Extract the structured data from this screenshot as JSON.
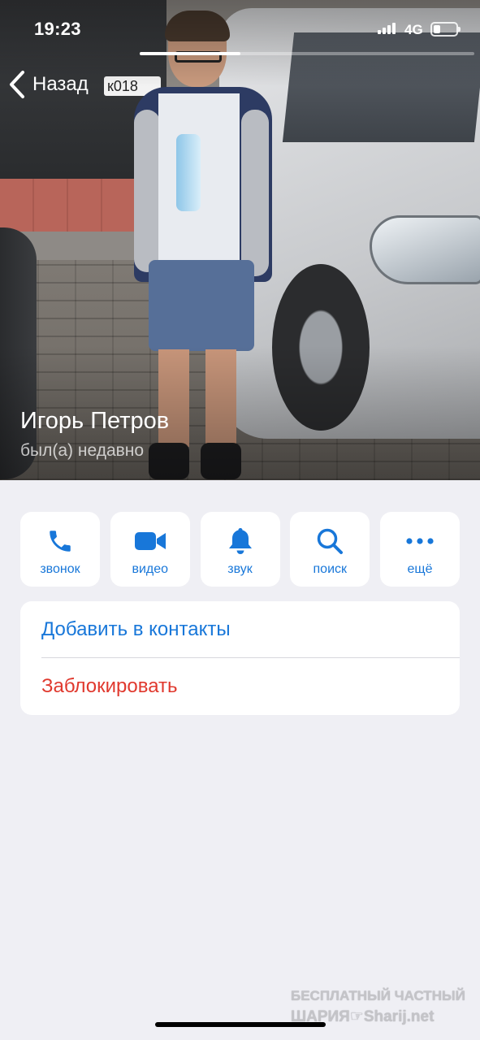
{
  "status_bar": {
    "time": "19:23",
    "network": "4G",
    "battery_level_fraction": 0.3
  },
  "photo": {
    "gallery_progress_fraction": 0.3
  },
  "navigation": {
    "back_label": "Назад"
  },
  "profile": {
    "name": "Игорь Петров",
    "last_seen": "был(а) недавно"
  },
  "actions": [
    {
      "label": "звонок",
      "icon": "phone-icon"
    },
    {
      "label": "видео",
      "icon": "video-camera-icon"
    },
    {
      "label": "звук",
      "icon": "bell-icon"
    },
    {
      "label": "поиск",
      "icon": "search-icon"
    },
    {
      "label": "ещё",
      "icon": "more-dots-icon"
    }
  ],
  "menu": {
    "add_contact": "Добавить в контакты",
    "block": "Заблокировать"
  },
  "watermark": {
    "line1": "БЕСПЛАТНЫЙ ЧАСТНЫЙ",
    "line2": "ШАРИЯ☞Sharij.net"
  },
  "colors": {
    "accent": "#1877d9",
    "destructive": "#e0392e",
    "background": "#efeff4",
    "card": "#ffffff"
  }
}
